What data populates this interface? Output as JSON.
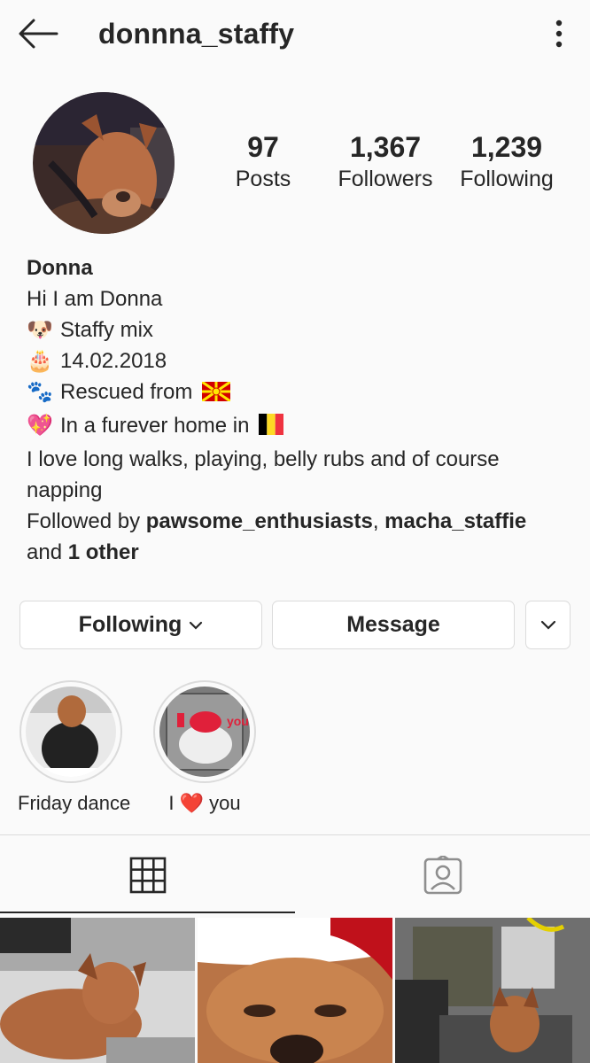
{
  "header": {
    "username": "donnna_staffy",
    "back_icon": "back-arrow-icon",
    "more_icon": "more-vertical-icon"
  },
  "stats": {
    "posts": {
      "value": "97",
      "label": "Posts"
    },
    "followers": {
      "value": "1,367",
      "label": "Followers"
    },
    "following": {
      "value": "1,239",
      "label": "Following"
    }
  },
  "bio": {
    "name": "Donna",
    "line1": "Hi I am Donna",
    "line2": "Staffy mix",
    "line3": "14.02.2018",
    "line4": "Rescued from",
    "line5": "In a furever home in",
    "line6": "I love long walks, playing, belly rubs and of course napping",
    "followed_by_prefix": "Followed by",
    "followed_user1": "pawsome_enthusiasts",
    "comma": ",",
    "followed_user2": "macha_staffie",
    "and_text": "and",
    "other_text": "1 other"
  },
  "actions": {
    "following_label": "Following",
    "message_label": "Message"
  },
  "highlights": [
    {
      "caption": "Friday dance"
    },
    {
      "caption_pre": "I",
      "caption_post": "you"
    }
  ],
  "tabs": {
    "grid_icon": "grid-icon",
    "tagged_icon": "tagged-person-icon"
  },
  "colors": {
    "text": "#262626",
    "border": "#dbdbdb",
    "heart": "#e8192c"
  }
}
